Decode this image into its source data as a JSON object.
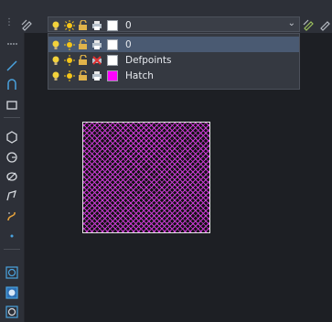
{
  "layer_combo": {
    "current_layer": "0",
    "current_color": "#ffffff"
  },
  "layer_dropdown": {
    "items": [
      {
        "name": "0",
        "color": "#ffffff",
        "selected": true,
        "plot": "printer-icon"
      },
      {
        "name": "Defpoints",
        "color": "#ffffff",
        "selected": false,
        "plot": "no-plot-icon"
      },
      {
        "name": "Hatch",
        "color": "#ff00ff",
        "selected": false,
        "plot": "printer-icon"
      }
    ]
  },
  "drawing": {
    "hatch_color": "#c83bd2",
    "boundary_color": "#e6e6e6"
  },
  "icons": {
    "toolbar": [
      "grip-icon",
      "layer-edit-icon",
      "layer-states-icon",
      "ellipsis-icon"
    ],
    "left_toolbar": [
      "line-icon",
      "arc-icon",
      "rectangle-icon",
      "polygon-icon",
      "circle-icon",
      "ellipse-icon",
      "curve-icon",
      "spline-icon",
      "point-icon",
      "block-icon",
      "insert-block-icon",
      "attribute-icon"
    ]
  }
}
